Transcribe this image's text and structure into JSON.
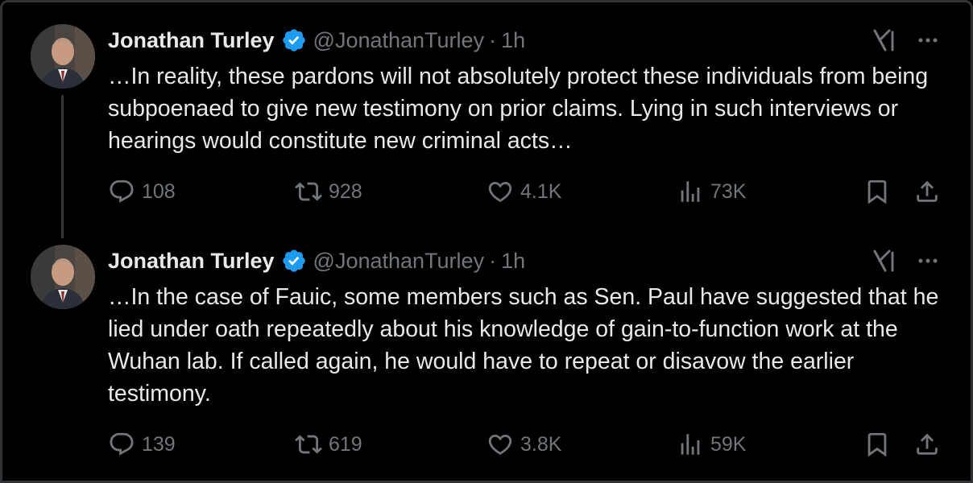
{
  "colors": {
    "background": "#000000",
    "text": "#e7e9ea",
    "secondary": "#71767b",
    "verified": "#1d9bf0",
    "thread_line": "#333639"
  },
  "tweets": [
    {
      "author_name": "Jonathan Turley",
      "handle": "@JonathanTurley",
      "separator": "·",
      "time": "1h",
      "verified_icon": "verified-badge-icon",
      "text": "…In reality, these pardons will not absolutely protect these individuals from being subpoenaed to give new testimony on prior claims. Lying in such interviews or hearings would constitute new criminal acts…",
      "replies": "108",
      "reposts": "928",
      "likes": "4.1K",
      "views": "73K"
    },
    {
      "author_name": "Jonathan Turley",
      "handle": "@JonathanTurley",
      "separator": "·",
      "time": "1h",
      "verified_icon": "verified-badge-icon",
      "text": "…In the case of Fauic, some members such as Sen. Paul have suggested that he lied under oath repeatedly about his knowledge of gain-to-function work at the Wuhan lab. If called again, he would have to repeat or disavow the earlier testimony.",
      "replies": "139",
      "reposts": "619",
      "likes": "3.8K",
      "views": "59K"
    }
  ]
}
